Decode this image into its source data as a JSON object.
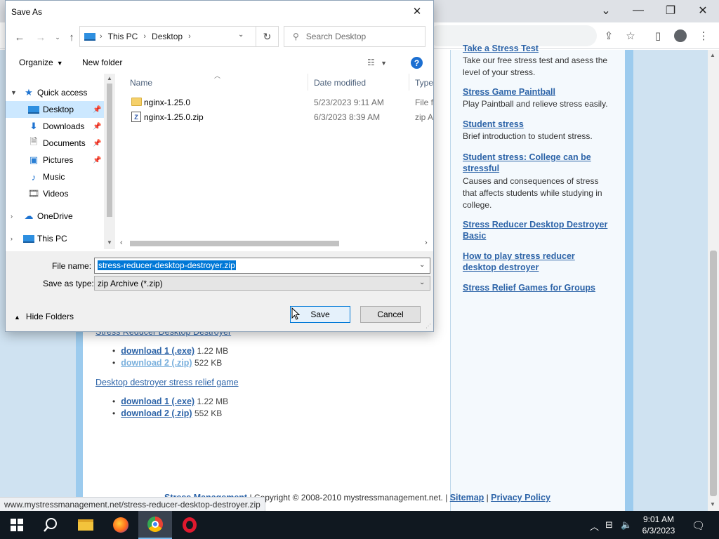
{
  "dialog": {
    "title": "Save As",
    "address": {
      "root": "This PC",
      "folder": "Desktop"
    },
    "search_placeholder": "Search Desktop",
    "toolbar": {
      "organize": "Organize",
      "new_folder": "New folder",
      "help": "?"
    },
    "nav": {
      "quick_access": "Quick access",
      "items": [
        "Desktop",
        "Downloads",
        "Documents",
        "Pictures",
        "Music",
        "Videos"
      ],
      "onedrive": "OneDrive",
      "this_pc": "This PC"
    },
    "columns": {
      "name": "Name",
      "date": "Date modified",
      "type": "Type"
    },
    "files": [
      {
        "name": "nginx-1.25.0",
        "date": "5/23/2023 9:11 AM",
        "type": "File folder"
      },
      {
        "name": "nginx-1.25.0.zip",
        "date": "6/3/2023 8:39 AM",
        "type": "zip Archive"
      }
    ],
    "file_name_label": "File name:",
    "file_name_value": "stress-reducer-desktop-destroyer.zip",
    "save_type_label": "Save as type:",
    "save_type_value": "zip Archive (*.zip)",
    "hide_folders": "Hide Folders",
    "save_label": "Save",
    "cancel_label": "Cancel"
  },
  "page": {
    "side_links": [
      {
        "title": "Take a Stress Test",
        "desc": "Take our free stress test and asess the level of your stress."
      },
      {
        "title": "Stress Game Paintball",
        "desc": "Play Paintball and relieve stress easily."
      },
      {
        "title": "Student stress",
        "desc": "Brief introduction to student stress."
      },
      {
        "title": "Student stress: College can be stressful",
        "desc": "Causes and consequences of stress that affects students while studying in college."
      },
      {
        "title": "Stress Reducer Desktop Destroyer Basic",
        "desc": ""
      },
      {
        "title": "How to play stress reducer desktop destroyer",
        "desc": ""
      },
      {
        "title": "Stress Relief Games for Groups",
        "desc": ""
      }
    ],
    "section1": {
      "title": "Stress Reducer Desktop Destroyer",
      "downloads": [
        {
          "link": "download 1 (.exe)",
          "size": "1.22 MB"
        },
        {
          "link": "download 2 (.zip)",
          "size": "522 KB"
        }
      ]
    },
    "section2": {
      "title": "Desktop destroyer stress relief game",
      "downloads": [
        {
          "link": "download 1 (.exe)",
          "size": "1.22 MB"
        },
        {
          "link": "download 2 (.zip)",
          "size": "552 KB"
        }
      ]
    },
    "footer": {
      "link": "Stress Management",
      "copyright": "| Copyright © 2008-2010 mystressmanagement.net. |",
      "sitemap": "Sitemap",
      "privacy": "Privacy Policy"
    },
    "status_url": "www.mystressmanagement.net/stress-reducer-desktop-destroyer.zip"
  },
  "taskbar": {
    "time": "9:01 AM",
    "date": "6/3/2023"
  },
  "colors": {
    "link": "#2d64a8",
    "selection": "#0078d7",
    "nav_selected": "#cce8ff",
    "taskbar": "#101820"
  }
}
